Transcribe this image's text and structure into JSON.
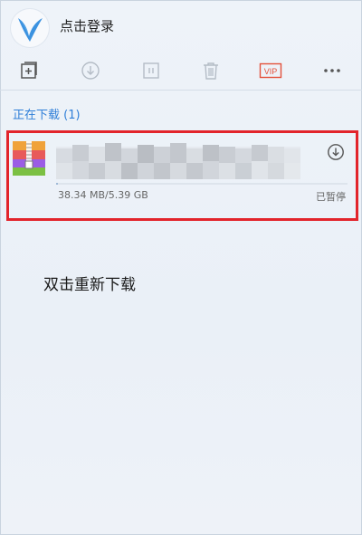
{
  "header": {
    "login_label": "点击登录"
  },
  "toolbar": {
    "items": [
      {
        "name": "new-task",
        "icon": "plus-square-icon"
      },
      {
        "name": "start",
        "icon": "download-circle-icon"
      },
      {
        "name": "pause",
        "icon": "pause-icon"
      },
      {
        "name": "delete",
        "icon": "trash-icon"
      },
      {
        "name": "vip",
        "icon": "vip-icon",
        "label": "VIP"
      },
      {
        "name": "more",
        "icon": "more-icon"
      }
    ]
  },
  "section": {
    "title": "正在下载 (1)"
  },
  "download": {
    "size_text": "38.34 MB/5.39 GB",
    "status": "已暂停",
    "progress": 0.0069,
    "icon": "zip-file-icon"
  },
  "annotation": {
    "text": "双击重新下载"
  },
  "colors": {
    "accent": "#2f7fd8",
    "highlight": "#e2242b",
    "vip": "#e3503b"
  }
}
